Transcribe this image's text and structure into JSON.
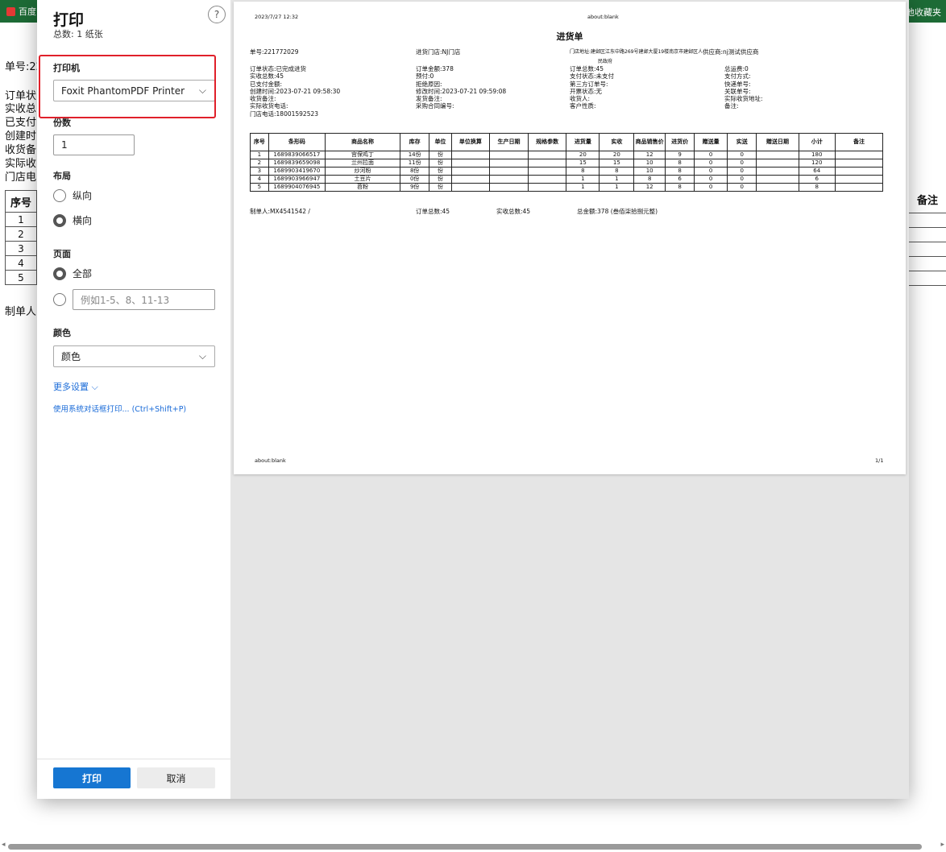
{
  "browser": {
    "bookmark_left": "百度",
    "bookmark_right": "他收藏夹"
  },
  "background_page": {
    "lines": [
      "单号:22",
      "订单状",
      "实收总",
      "已支付",
      "创建时",
      "收货备",
      "实际收",
      "门店电"
    ],
    "table_header": "序号",
    "rows": [
      "1",
      "2",
      "3",
      "4",
      "5"
    ],
    "right_header": "备注",
    "maker": "制单人:"
  },
  "dialog": {
    "title": "打印",
    "subtitle": "总数: 1 纸张",
    "help": "?",
    "printer_label": "打印机",
    "printer_value": "Foxit PhantomPDF Printer",
    "copies_label": "份数",
    "copies_value": "1",
    "layout_label": "布局",
    "layout_portrait": "纵向",
    "layout_landscape": "横向",
    "pages_label": "页面",
    "pages_all": "全部",
    "pages_placeholder": "例如1-5、8、11-13",
    "color_label": "颜色",
    "color_value": "颜色",
    "more_settings": "更多设置 ⌵",
    "system_dialog": "使用系统对话框打印... (Ctrl+Shift+P)",
    "print_button": "打印",
    "cancel_button": "取消"
  },
  "preview": {
    "datetime": "2023/7/27 12:32",
    "url_top": "about:blank",
    "title": "进货单",
    "order_no": "单号:221772029",
    "store": "进货门店:NJ门店",
    "address": "门店地址:建邺区江东中路269号建邺大厦19楼南京市建邺区人",
    "address2": "民政府",
    "supplier": "供应商:nj测试供应商",
    "col1": [
      "订单状态:已完成进货",
      "实收总数:45",
      "已支付金额:",
      "创建时间:2023-07-21 09:58:30",
      "收货备注:",
      "实际收货电话:",
      "门店电话:18001592523"
    ],
    "col2": [
      "订单金额:378",
      "预付:0",
      "拒绝原因:",
      "修改时间:2023-07-21 09:59:08",
      "发货备注:",
      "采购合同编号:"
    ],
    "col3": [
      "订单总数:45",
      "支付状态:未支付",
      "第三方订单号:",
      "开票状态:无",
      "收货人:",
      "客户性质:"
    ],
    "col4": [
      "总运费:0",
      "支付方式:",
      "快递单号:",
      "关联单号:",
      "实际收货地址:",
      "备注:"
    ],
    "headers": [
      "序号",
      "条形码",
      "商品名称",
      "库存",
      "单位",
      "单位换算",
      "生产日期",
      "规格参数",
      "进货量",
      "实收",
      "商品销售价",
      "进货价",
      "赠送量",
      "实送",
      "赠送日期",
      "小计",
      "备注"
    ],
    "rows": [
      [
        "1",
        "1689839066517",
        "宫保鸡丁",
        "14份",
        "份",
        "",
        "",
        "",
        "20",
        "20",
        "12",
        "9",
        "0",
        "0",
        "",
        "180",
        ""
      ],
      [
        "2",
        "1689839659098",
        "兰州拉面",
        "11份",
        "份",
        "",
        "",
        "",
        "15",
        "15",
        "10",
        "8",
        "0",
        "0",
        "",
        "120",
        ""
      ],
      [
        "3",
        "1689903419670",
        "炒河粉",
        "8份",
        "份",
        "",
        "",
        "",
        "8",
        "8",
        "10",
        "8",
        "0",
        "0",
        "",
        "64",
        ""
      ],
      [
        "4",
        "1689903966947",
        "土豆片",
        "0份",
        "份",
        "",
        "",
        "",
        "1",
        "1",
        "8",
        "6",
        "0",
        "0",
        "",
        "6",
        ""
      ],
      [
        "5",
        "1689904076945",
        "苕粉",
        "9份",
        "份",
        "",
        "",
        "",
        "1",
        "1",
        "12",
        "8",
        "0",
        "0",
        "",
        "8",
        ""
      ]
    ],
    "maker": "制单人:MX4541542 /",
    "total_qty": "订单总数:45",
    "received_qty": "实收总数:45",
    "total_amount": "总金额:378 (叁佰柒拾捌元整)",
    "url_bottom": "about:blank",
    "page_num": "1/1"
  },
  "colors": {
    "accent": "#1676d2",
    "highlight": "#e0202a",
    "bookmark_bar": "#1d6b36"
  }
}
